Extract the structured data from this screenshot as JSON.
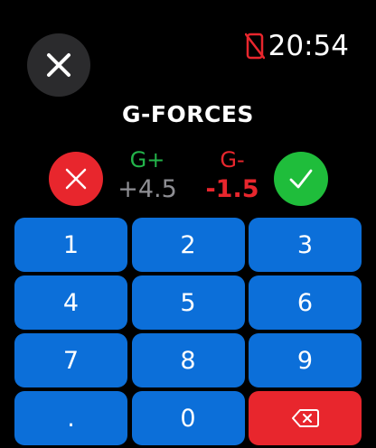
{
  "status": {
    "time": "20:54",
    "icons": [
      "phone-disconnected-icon"
    ],
    "status_icon_color": "#e8262d"
  },
  "header": {
    "close_icon": "close-icon",
    "title": "G-FORCES"
  },
  "values": {
    "g_plus": {
      "label": "G+",
      "value": "+4.5",
      "label_color": "#23b44a",
      "value_color": "#8e8e93"
    },
    "g_minus": {
      "label": "G-",
      "value": "-1.5",
      "color": "#e8262d"
    }
  },
  "actions": {
    "reject_icon": "close-icon",
    "accept_icon": "checkmark-icon",
    "reject_color": "#e8262d",
    "accept_color": "#1fbd3b"
  },
  "keypad": {
    "key_color": "#0c6fd9",
    "backspace_color": "#e8262d",
    "backspace_icon": "backspace-icon",
    "keys": [
      "1",
      "2",
      "3",
      "4",
      "5",
      "6",
      "7",
      "8",
      "9",
      ".",
      "0"
    ]
  }
}
